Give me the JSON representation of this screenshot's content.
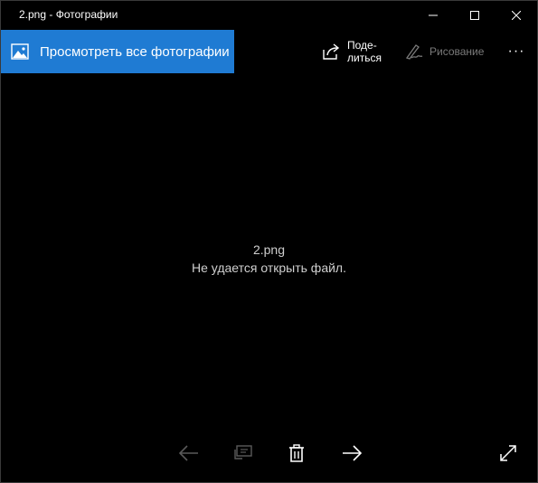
{
  "window": {
    "title": "2.png - Фотографии"
  },
  "toolbar": {
    "view_all_label": "Просмотреть все фотографии",
    "share_label_line1": "Поде-",
    "share_label_line2": "литься",
    "draw_label": "Рисование",
    "more_label": "···"
  },
  "viewer": {
    "file_name": "2.png",
    "error_message": "Не удается открыть файл."
  },
  "icons": {
    "minimize": "minimize-icon",
    "maximize": "maximize-icon",
    "close": "close-icon",
    "photos": "photo-icon",
    "share": "share-icon",
    "draw": "pen-icon",
    "back": "arrow-left-icon",
    "slideshow": "slideshow-icon",
    "delete": "trash-icon",
    "forward": "arrow-right-icon",
    "fullscreen": "fullscreen-icon"
  },
  "colors": {
    "accent": "#1f7bd3",
    "background": "#000000",
    "disabled": "#6a6a6a",
    "text": "#ffffff"
  }
}
